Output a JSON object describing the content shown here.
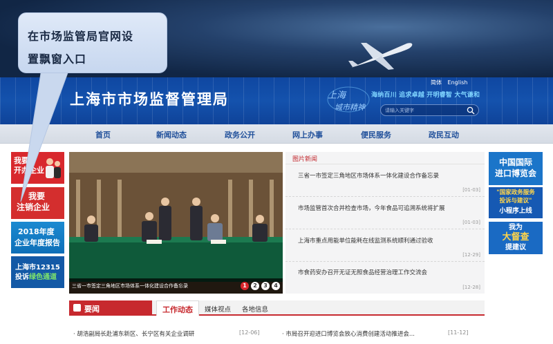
{
  "callout": {
    "line1": "在市场监管局官网设",
    "line2": "置飘窗入口"
  },
  "header": {
    "site_title": "上海市市场监督管理局",
    "lang_cn": "简体",
    "lang_en": "English",
    "spirit_slogan": "海纳百川 追求卓越 开明睿智 大气谦和",
    "spirit_logo_line1": "上海",
    "spirit_logo_line2": "城市精神",
    "search_placeholder": "请输入关键字"
  },
  "nav": {
    "items": [
      {
        "label": "首页"
      },
      {
        "label": "新闻动态"
      },
      {
        "label": "政务公开"
      },
      {
        "label": "网上办事"
      },
      {
        "label": "便民服务"
      },
      {
        "label": "政民互动"
      }
    ]
  },
  "left_ads": [
    {
      "line1": "我要",
      "line2": "开办企业"
    },
    {
      "line1": "我要",
      "line2": "注销企业"
    },
    {
      "line1": "2018年度",
      "line2": "企业年度报告"
    },
    {
      "line1": "上海市12315",
      "line2": "投诉",
      "line2b": "绿色通道"
    }
  ],
  "slide": {
    "caption": "三省一市签定三角地区市场体系一体化建设合作备忘录",
    "dots": [
      "1",
      "2",
      "3",
      "4"
    ],
    "active_dot": 1
  },
  "picture_news": {
    "title": "图片新闻",
    "items": [
      {
        "text": "三省一市签定三角地区市场体系一体化建设合作备忘录",
        "date": "[01-03]"
      },
      {
        "text": "市场监管首次合并检查市场，今年食品可追溯系统将扩展",
        "date": "[01-03]"
      },
      {
        "text": "上海市重点用能单位能耗在线监测系统顺利通过验收",
        "date": "[12-29]"
      },
      {
        "text": "市食药安办召开无证无照食品经营治理工作交流会",
        "date": "[12-28]"
      }
    ]
  },
  "right_ads": [
    {
      "line1": "中国国际",
      "line2": "进口博览会"
    },
    {
      "line1": "\"国家政务服务",
      "line2": "投诉与建议\"",
      "line3": "小程序上线"
    },
    {
      "line1": "我为",
      "line2": "大督查",
      "line3": "提建议"
    }
  ],
  "news_tabs": {
    "section_label": "要闻",
    "tabs": [
      {
        "label": "工作动态",
        "active": true
      },
      {
        "label": "媒体视点",
        "active": false
      },
      {
        "label": "各地信息",
        "active": false
      }
    ],
    "rows": [
      {
        "text": "胡浩副局长赴浦东新区、长宁区有关企业调研",
        "date": "[12-06]"
      },
      {
        "text": "市局召开迎进口博览会放心消费创建活动推进会...",
        "date": "[11-12]"
      }
    ]
  },
  "colors": {
    "brand_blue": "#0f47a1",
    "accent_red": "#c7292e",
    "nav_text": "#1f4f9a"
  }
}
